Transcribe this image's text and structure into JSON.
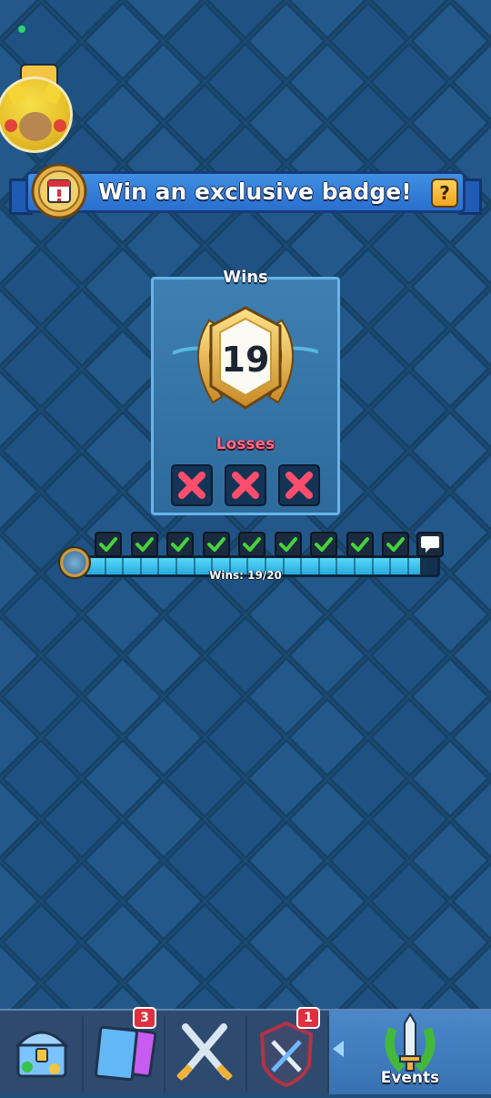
{
  "banner": {
    "title": "Win an exclusive badge!",
    "help_label": "?"
  },
  "panel": {
    "wins_label": "Wins",
    "wins_count": "19",
    "losses_label": "Losses",
    "losses": [
      "x-mark-icon",
      "x-mark-icon",
      "x-mark-icon"
    ]
  },
  "progress": {
    "text": "Wins: 19/20",
    "wins": 19,
    "target": 20,
    "fraction": 0.95,
    "milestones_completed": 9
  },
  "nav": {
    "items": [
      {
        "icon": "chest-icon",
        "badge": ""
      },
      {
        "icon": "cards-icon",
        "badge": "3"
      },
      {
        "icon": "crossed-swords-icon",
        "badge": ""
      },
      {
        "icon": "clan-shield-icon",
        "badge": "1"
      },
      {
        "icon": "events-sword-laurel-icon",
        "badge": "",
        "label": "Events",
        "selected": true
      }
    ]
  },
  "colors": {
    "background": "#1e4e77",
    "banner": "#2f7ad6",
    "progress_fill": "#3cc1ee",
    "check": "#46d33c",
    "loss_x": "#ff4d6d",
    "nav_selected": "#4380c1"
  }
}
